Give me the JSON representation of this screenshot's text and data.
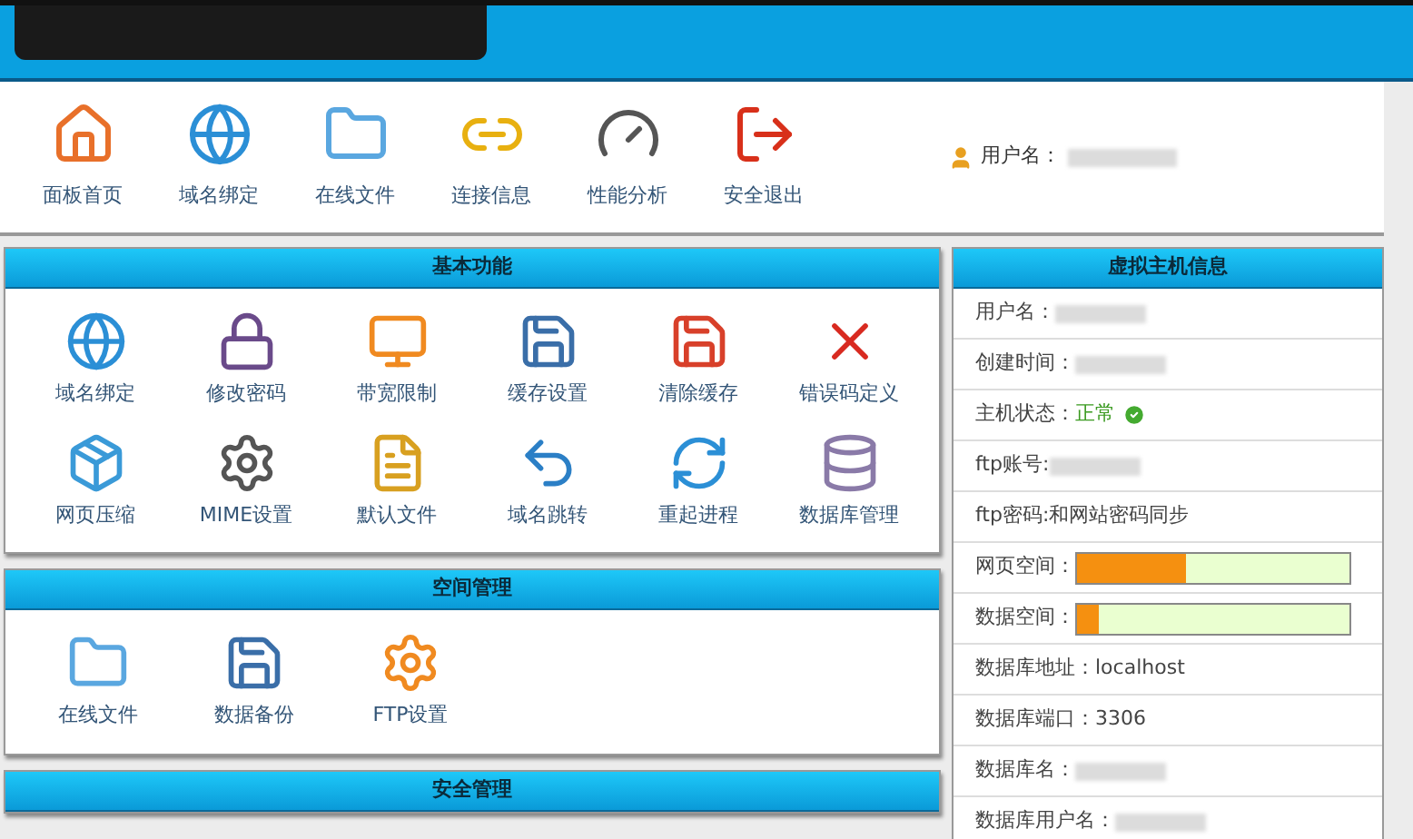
{
  "toolbar": {
    "items": [
      {
        "label": "面板首页"
      },
      {
        "label": "域名绑定"
      },
      {
        "label": "在线文件"
      },
      {
        "label": "连接信息"
      },
      {
        "label": "性能分析"
      },
      {
        "label": "安全退出"
      }
    ],
    "user_label": "用户名："
  },
  "sections": [
    {
      "title": "基本功能",
      "items": [
        {
          "label": "域名绑定"
        },
        {
          "label": "修改密码"
        },
        {
          "label": "带宽限制"
        },
        {
          "label": "缓存设置"
        },
        {
          "label": "清除缓存"
        },
        {
          "label": "错误码定义"
        },
        {
          "label": "网页压缩"
        },
        {
          "label": "MIME设置"
        },
        {
          "label": "默认文件"
        },
        {
          "label": "域名跳转"
        },
        {
          "label": "重起进程"
        },
        {
          "label": "数据库管理"
        }
      ]
    },
    {
      "title": "空间管理",
      "items": [
        {
          "label": "在线文件"
        },
        {
          "label": "数据备份"
        },
        {
          "label": "FTP设置"
        }
      ]
    },
    {
      "title": "安全管理"
    }
  ],
  "host_info": {
    "title": "虚拟主机信息",
    "rows": [
      {
        "kind": "redacted",
        "label": "用户名："
      },
      {
        "kind": "redacted",
        "label": "创建时间："
      },
      {
        "kind": "status",
        "label": "主机状态：",
        "value": "正常"
      },
      {
        "kind": "redacted",
        "label": "ftp账号:"
      },
      {
        "kind": "text",
        "label": "ftp密码:",
        "value": "和网站密码同步"
      },
      {
        "kind": "bar",
        "label": "网页空间：",
        "level": 0.4
      },
      {
        "kind": "bar",
        "label": "数据空间：",
        "level": 0.08
      },
      {
        "kind": "text",
        "label": "数据库地址：",
        "value": "localhost"
      },
      {
        "kind": "text",
        "label": "数据库端口：",
        "value": "3306"
      },
      {
        "kind": "redacted",
        "label": "数据库名："
      },
      {
        "kind": "redacted",
        "label": "数据库用户名："
      }
    ]
  }
}
